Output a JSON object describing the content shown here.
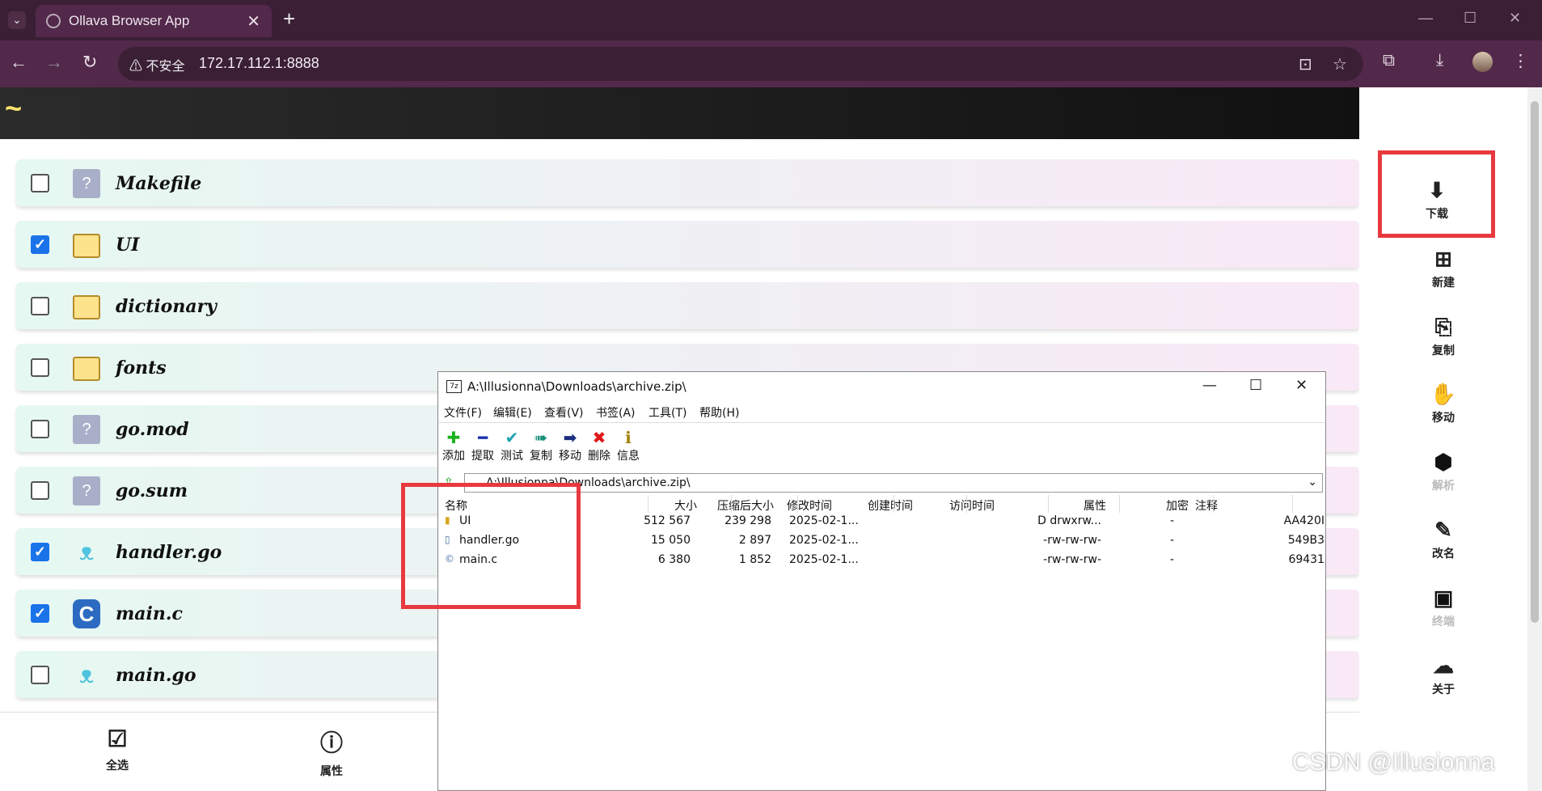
{
  "browser": {
    "tab_title": "Ollava Browser App",
    "security_label": "不安全",
    "url": "172.17.112.1:8888"
  },
  "page": {
    "header_symbol": "~",
    "files": [
      {
        "name": "Makefile",
        "type": "unknown",
        "checked": false
      },
      {
        "name": "UI",
        "type": "folder",
        "checked": true
      },
      {
        "name": "dictionary",
        "type": "folder",
        "checked": false
      },
      {
        "name": "fonts",
        "type": "folder",
        "checked": false
      },
      {
        "name": "go.mod",
        "type": "unknown",
        "checked": false
      },
      {
        "name": "go.sum",
        "type": "unknown",
        "checked": false
      },
      {
        "name": "handler.go",
        "type": "go",
        "checked": true
      },
      {
        "name": "main.c",
        "type": "c",
        "checked": true
      },
      {
        "name": "main.go",
        "type": "go",
        "checked": false
      }
    ],
    "bottom_bar": {
      "select_all": "全选",
      "properties": "属性"
    }
  },
  "sidebar": {
    "download": "下载",
    "new": "新建",
    "copy": "复制",
    "move": "移动",
    "extract": "解析",
    "rename": "改名",
    "terminal": "终端",
    "about": "关于"
  },
  "zip_window": {
    "title": "A:\\Illusionna\\Downloads\\archive.zip\\",
    "menu": [
      "文件(F)",
      "编辑(E)",
      "查看(V)",
      "书签(A)",
      "工具(T)",
      "帮助(H)"
    ],
    "tools": [
      "添加",
      "提取",
      "测试",
      "复制",
      "移动",
      "删除",
      "信息"
    ],
    "address": "A:\\Illusionna\\Downloads\\archive.zip\\",
    "columns": [
      "名称",
      "大小",
      "压缩后大小",
      "修改时间",
      "创建时间",
      "访问时间",
      "属性",
      "加密",
      "注释"
    ],
    "rows": [
      {
        "name": "UI",
        "size": "512 567",
        "packed": "239 298",
        "modified": "2025-02-1...",
        "attr": "D drwxrw...",
        "enc": "-",
        "crc": "AA420I"
      },
      {
        "name": "handler.go",
        "size": "15 050",
        "packed": "2 897",
        "modified": "2025-02-1...",
        "attr": "-rw-rw-rw-",
        "enc": "-",
        "crc": "549B3"
      },
      {
        "name": "main.c",
        "size": "6 380",
        "packed": "1 852",
        "modified": "2025-02-1...",
        "attr": "-rw-rw-rw-",
        "enc": "-",
        "crc": "69431"
      }
    ]
  },
  "watermark": "CSDN @Illusionna",
  "colors": {
    "highlight": "#e8393f",
    "checkbox": "#1a73e8",
    "chrome": "#52294a"
  }
}
